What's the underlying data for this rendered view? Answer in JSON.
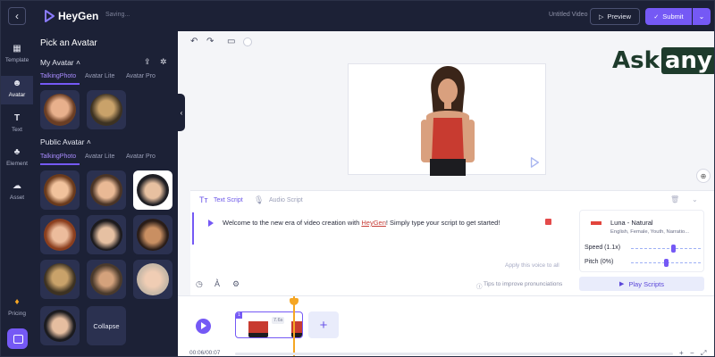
{
  "header": {
    "brand": "HeyGen",
    "status": "Saving...",
    "project_title": "Untitled Video",
    "preview_label": "Preview",
    "submit_label": "Submit"
  },
  "rail": [
    {
      "label": "Template",
      "icon": "template-icon"
    },
    {
      "label": "Avatar",
      "icon": "avatar-icon"
    },
    {
      "label": "Text",
      "icon": "text-icon"
    },
    {
      "label": "Element",
      "icon": "element-icon"
    },
    {
      "label": "Asset",
      "icon": "asset-icon"
    },
    {
      "label": "Pricing",
      "icon": "pricing-icon"
    }
  ],
  "panel": {
    "title": "Pick an Avatar",
    "my_avatar": "My Avatar",
    "public_avatar": "Public Avatar",
    "tabs": [
      "TalkingPhoto",
      "Avatar Lite",
      "Avatar Pro"
    ],
    "collapse_label": "Collapse"
  },
  "watermark": {
    "part1": "Ask",
    "part2": "any"
  },
  "script": {
    "tab_text": "Text Script",
    "tab_audio": "Audio Script",
    "text_before": "Welcome to the new era of video creation with ",
    "brand_word": "HeyGen",
    "text_after": "! Simply type your script to get started!",
    "apply_link": "Apply this voice to all",
    "tips": "Tips to improve pronunciations"
  },
  "voice": {
    "name": "Luna - Natural",
    "description": "English, Female, Youth, Narratio...",
    "speed_label": "Speed (1.1x)",
    "speed_value": 1.1,
    "pitch_label": "Pitch (0%)",
    "pitch_value": 0,
    "play_scripts": "Play Scripts"
  },
  "timeline": {
    "clip_number": "1",
    "clip_duration": "7.6s",
    "timecode": "00:06/00:07"
  },
  "colors": {
    "accent": "#7559f5",
    "sidebar_bg": "#1c2136",
    "playhead": "#f5a623"
  }
}
